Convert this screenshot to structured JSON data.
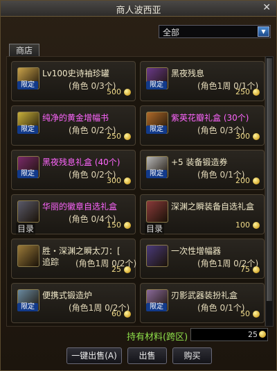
{
  "window": {
    "title": "商人波西亚",
    "close_glyph": "✕"
  },
  "filter": {
    "selected": "全部"
  },
  "tab": {
    "label": "商店"
  },
  "items": [
    {
      "name": "Lv100史诗袖珍罐",
      "name_color": "#f0e8c8",
      "limit": "(角色 0/3个)",
      "price": "500",
      "tag": "",
      "badge": "限定",
      "icon": "jar-icon"
    },
    {
      "name": "黑夜残息",
      "name_color": "#f0e8c8",
      "limit": "(角色1周 0/1个)",
      "price": "250",
      "tag": "",
      "badge": "限定",
      "icon": "dark-orb-icon"
    },
    {
      "name": "纯净的黄金增幅书",
      "name_color": "#ff66ff",
      "limit": "(角色 0/2个)",
      "price": "250",
      "tag": "",
      "badge": "限定",
      "icon": "book-icon"
    },
    {
      "name": "紫英花瓣礼盒 (30个)",
      "name_color": "#ff66ff",
      "limit": "(角色 0/3个)",
      "price": "300",
      "tag": "",
      "badge": "限定",
      "icon": "gift-box-icon"
    },
    {
      "name": "黑夜残息礼盒 (40个)",
      "name_color": "#ff66ff",
      "limit": "(角色 0/2个)",
      "price": "300",
      "tag": "",
      "badge": "限定",
      "icon": "dark-gift-icon"
    },
    {
      "name": "+5 装备锻造券",
      "name_color": "#f0e8c8",
      "limit": "(角色 0/1个)",
      "price": "200",
      "tag": "",
      "badge": "限定",
      "icon": "ticket-icon"
    },
    {
      "name": "华丽的徽章自选礼盒",
      "name_color": "#ff66ff",
      "limit": "(角色 0/4个)",
      "price": "150",
      "tag": "目录",
      "badge": "",
      "icon": "badge-box-icon"
    },
    {
      "name": "深渊之瞬装备自选礼盒",
      "name_color": "#f0e8c8",
      "limit": "",
      "price": "100",
      "tag": "目录",
      "badge": "",
      "icon": "equipment-box-icon"
    },
    {
      "name": "胜・深渊之瞬太刀：[",
      "name2": "追踪",
      "name_color": "#f0e8c8",
      "limit": "(角色1周 0/2个)",
      "price": "25",
      "tag": "",
      "badge": "",
      "icon": "katana-icon"
    },
    {
      "name": "一次性增幅器",
      "name_color": "#f0e8c8",
      "limit": "(角色1周 0/2个)",
      "price": "75",
      "tag": "",
      "badge": "",
      "icon": "amplifier-icon"
    },
    {
      "name": "便携式锻造炉",
      "name_color": "#f0e8c8",
      "limit": "(角色1周 0/2个)",
      "price": "60",
      "tag": "",
      "badge": "限定",
      "icon": "forge-icon"
    },
    {
      "name": "刃影武器装扮礼盒",
      "name_color": "#f0e8c8",
      "limit": "(角色 0/1个)",
      "price": "50",
      "tag": "",
      "badge": "限定",
      "icon": "weapon-gift-icon"
    }
  ],
  "material": {
    "label": "持有材料(跨区)",
    "value": "25"
  },
  "buttons": {
    "sell_all": "一键出售(A)",
    "sell": "出售",
    "buy": "购买"
  }
}
